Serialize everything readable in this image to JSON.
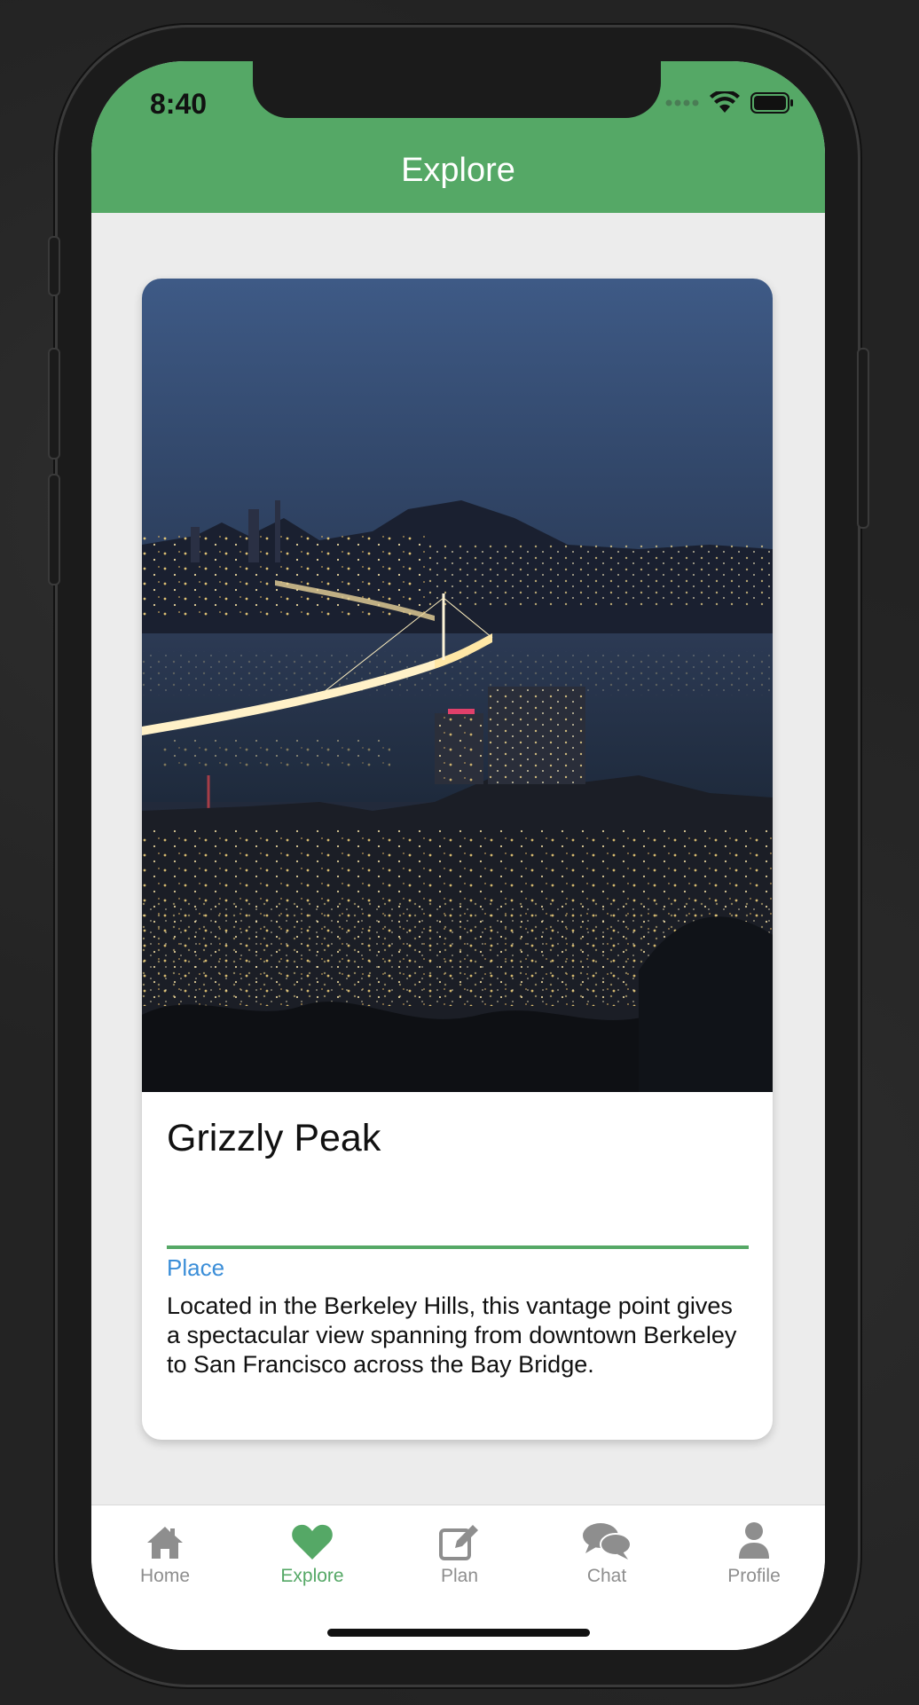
{
  "status_bar": {
    "time": "8:40"
  },
  "header": {
    "title": "Explore"
  },
  "card": {
    "title": "Grizzly Peak",
    "category": "Place",
    "description": "Located in the Berkeley Hills, this vantage point gives a spectacular view spanning from downtown Berkeley to San Francisco across the Bay Bridge.",
    "image": "night-city-bay-bridge-photo"
  },
  "tabs": [
    {
      "label": "Home",
      "icon": "home-icon",
      "active": false
    },
    {
      "label": "Explore",
      "icon": "heart-icon",
      "active": true
    },
    {
      "label": "Plan",
      "icon": "edit-icon",
      "active": false
    },
    {
      "label": "Chat",
      "icon": "chat-icon",
      "active": false
    },
    {
      "label": "Profile",
      "icon": "user-icon",
      "active": false
    }
  ],
  "colors": {
    "accent": "#55a866",
    "link": "#3b8ed8",
    "inactive_tab": "#8e8e8e"
  }
}
